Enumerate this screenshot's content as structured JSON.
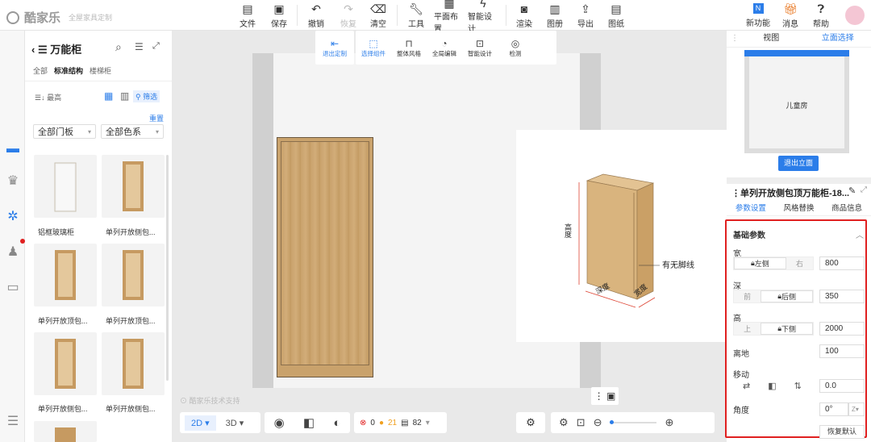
{
  "brand": {
    "name": "酷家乐",
    "sub": "全屋家具定制"
  },
  "toolbar": {
    "file": "文件",
    "save": "保存",
    "undo": "撤销",
    "redo": "恢复",
    "clear": "清空",
    "tools": "工具",
    "layout": "平面布置",
    "smart": "智能设计",
    "render": "渲染",
    "drawings": "图册",
    "export": "导出",
    "paper": "图纸",
    "new": "新功能",
    "msg": "消息",
    "help": "帮助"
  },
  "left": {
    "back": "万能柜",
    "tabs": [
      "全部",
      "标准结构",
      "楼梯柜"
    ],
    "sort": "最高",
    "filter": "筛选",
    "reset": "重置",
    "door": "全部门板",
    "color": "全部色系",
    "items": [
      "铝框玻璃柜",
      "单列开放侧包...",
      "单列开放顶包...",
      "单列开放顶包...",
      "单列开放侧包...",
      "单列开放侧包..."
    ]
  },
  "canvas": {
    "exit": "退出定制",
    "select": "选择组件",
    "style": "整体风格",
    "global": "全局编辑",
    "smartd": "智能设计",
    "check": "检测",
    "preview": {
      "h": "高度",
      "d": "深度",
      "w": "宽度",
      "base": "有无脚线"
    },
    "watermark": "酷家乐技术支持",
    "bottom": {
      "v2d": "2D",
      "v3d": "3D",
      "err": "0",
      "warn": "21",
      "count": "82"
    }
  },
  "right": {
    "tab_view": "视图",
    "tab_elev": "立面选择",
    "room": "儿童房",
    "exit_elev": "退出立面",
    "title": "单列开放侧包顶万能柜-18...",
    "tabs": [
      "参数设置",
      "风格替换",
      "商品信息"
    ],
    "basic": "基础参数",
    "width": {
      "label": "宽",
      "a": "左侧",
      "b": "右",
      "val": "800"
    },
    "depth": {
      "label": "深",
      "a": "前",
      "b": "后侧",
      "val": "350"
    },
    "height": {
      "label": "高",
      "a": "上",
      "b": "下侧",
      "val": "2000"
    },
    "ground": {
      "label": "离地",
      "val": "100"
    },
    "move": {
      "label": "移动",
      "val": "0.0"
    },
    "angle": {
      "label": "角度",
      "val": "0°",
      "unit": "Z"
    },
    "restore": "恢复默认"
  },
  "colors": {
    "accent": "#2b7de9",
    "highlight": "#e02020"
  }
}
